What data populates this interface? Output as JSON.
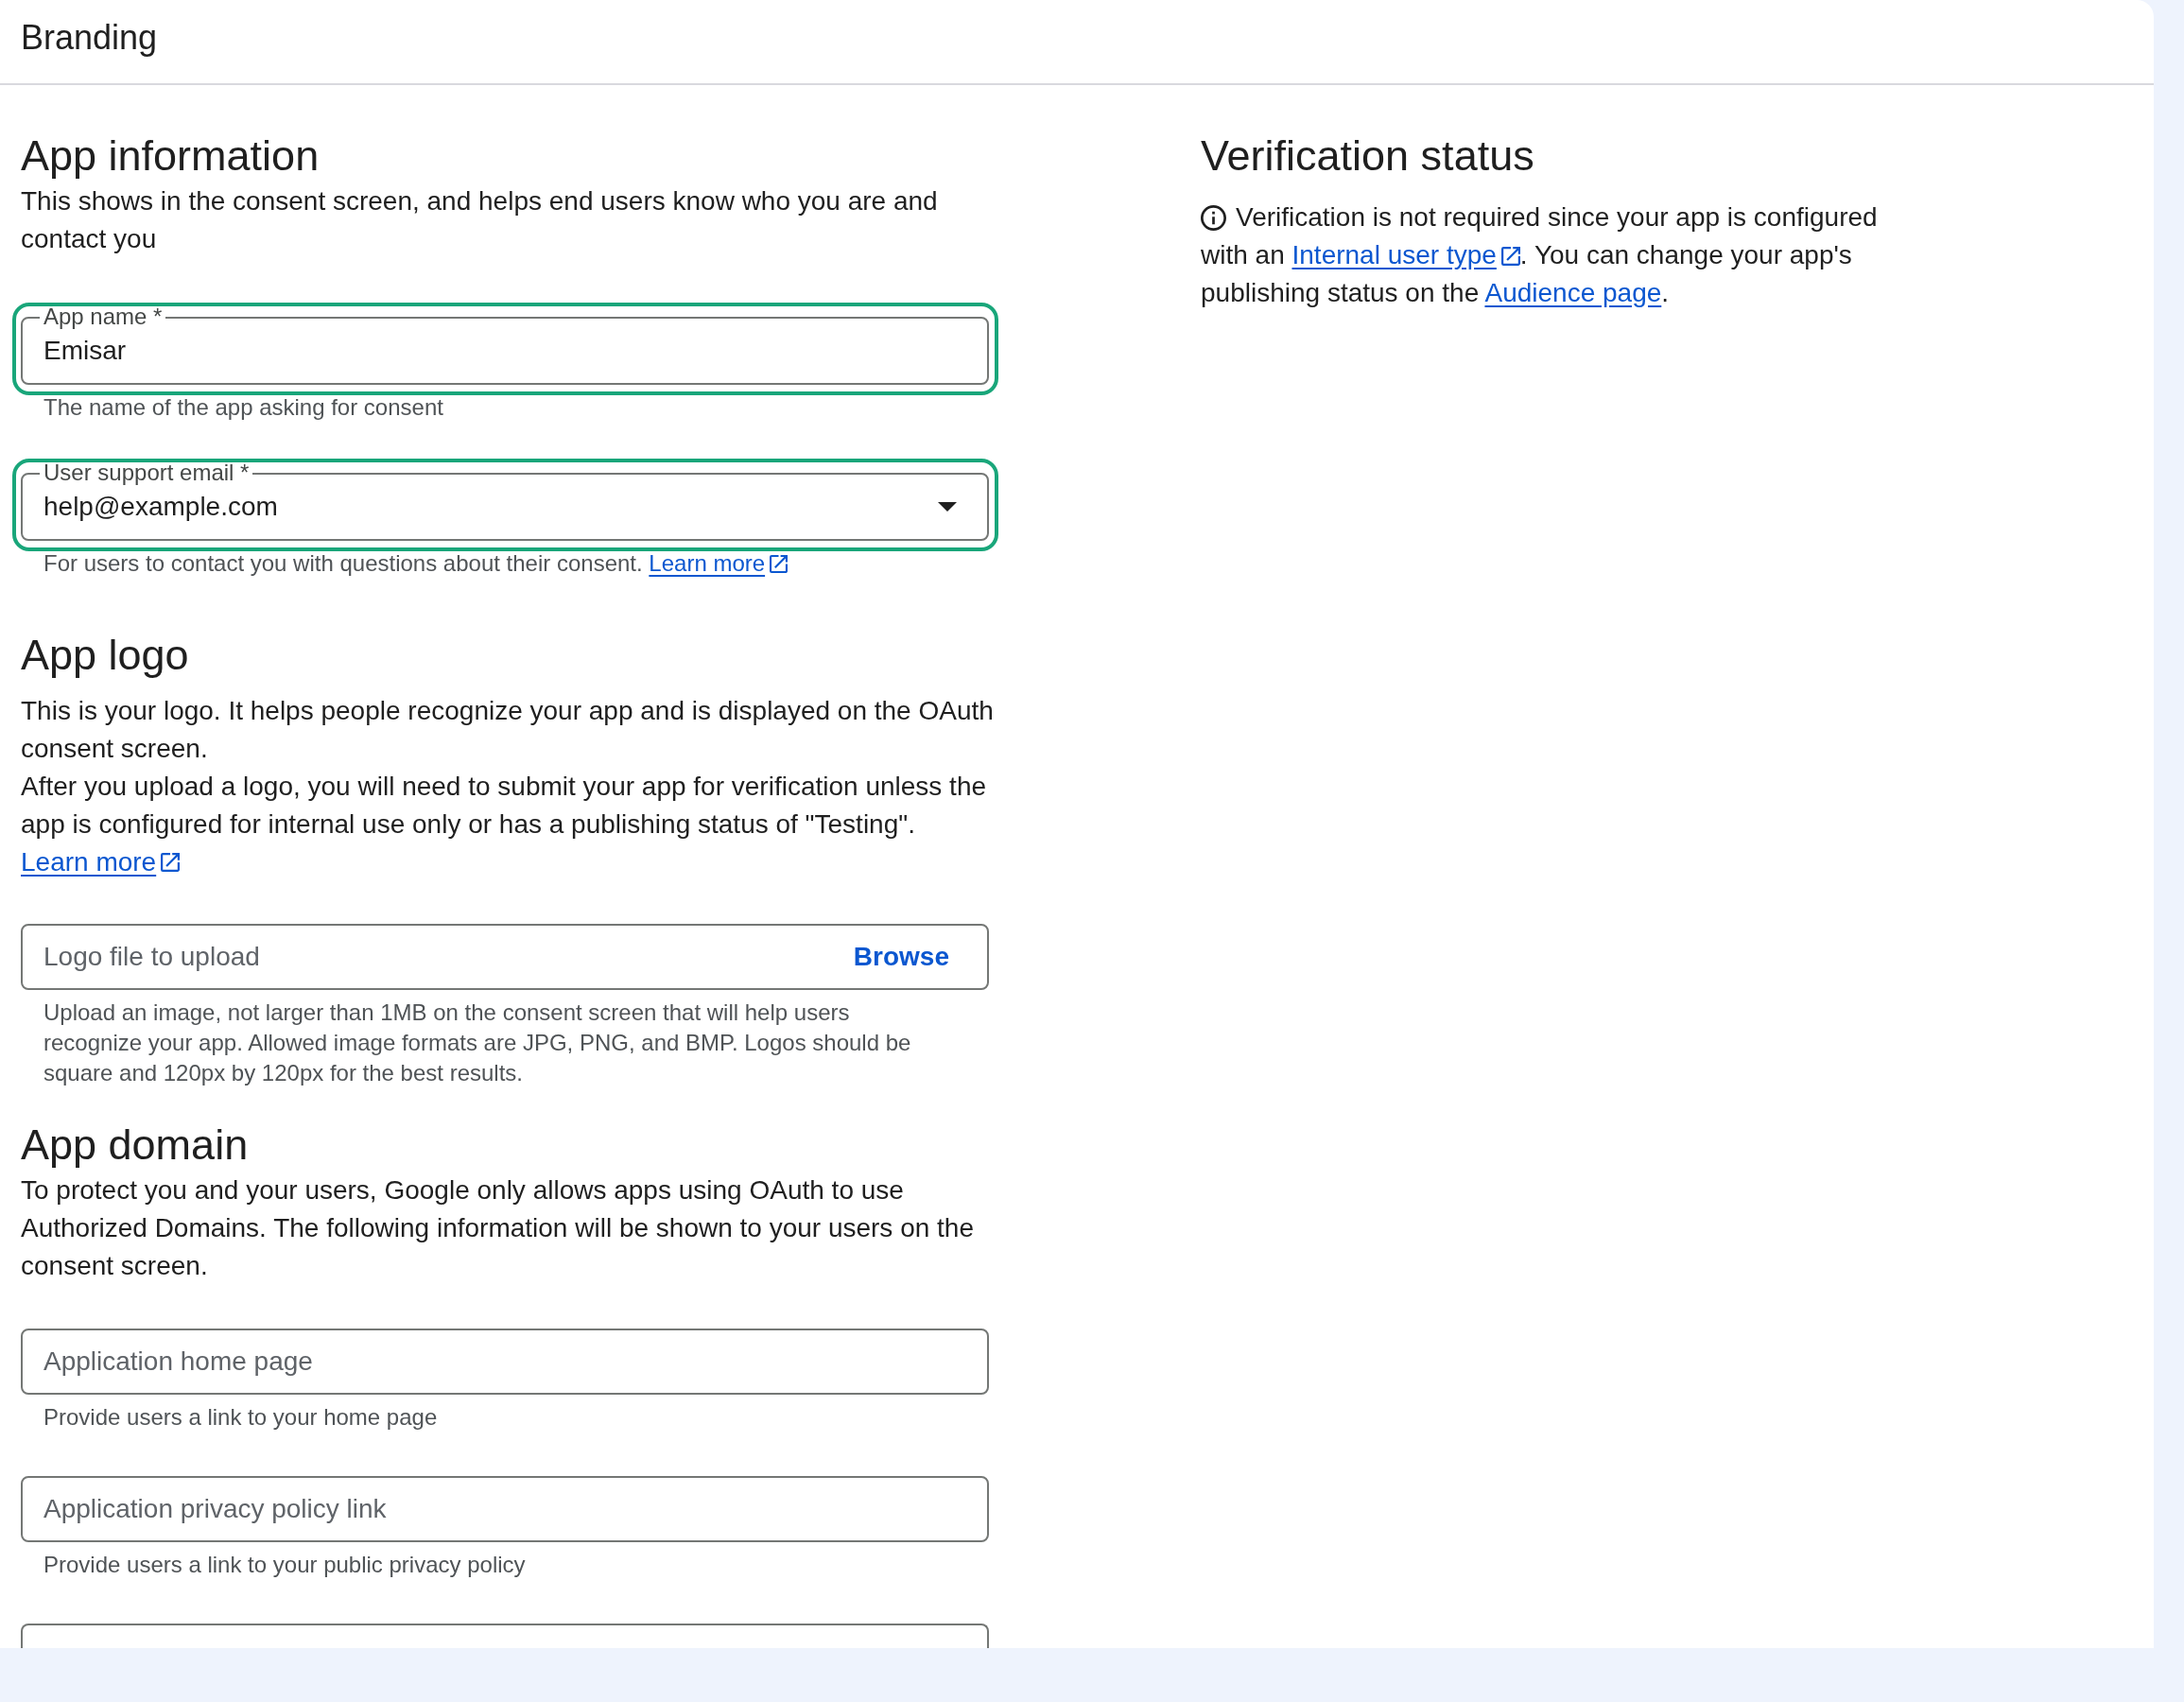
{
  "page_title": "Branding",
  "app_information": {
    "title": "App information",
    "description": "This shows in the consent screen, and helps end users know who you are and contact you",
    "fields": [
      {
        "kind": "text",
        "label": "App name *",
        "value": "Emisar",
        "hint": [
          {
            "kind": "text",
            "text": "The name of the app asking for consent"
          }
        ],
        "highlighted": true
      },
      {
        "kind": "dropdown",
        "label": "User support email *",
        "value": "help@example.com",
        "hint": [
          {
            "kind": "text",
            "text": "For users to contact you with questions about their consent. "
          },
          {
            "kind": "link",
            "text": "Learn more",
            "external": true
          }
        ],
        "highlighted": true
      }
    ]
  },
  "app_logo": {
    "title": "App logo",
    "paragraphs": [
      "This is your logo. It helps people recognize your app and is displayed on the OAuth consent screen.",
      "After you upload a logo, you will need to submit your app for verification unless the app is configured for internal use only or has a publishing status of \"Testing\"."
    ],
    "link": {
      "text": "Learn more",
      "external": true
    },
    "upload": {
      "placeholder": "Logo file to upload",
      "button": "Browse",
      "hint": "Upload an image, not larger than 1MB on the consent screen that will help users recognize your app. Allowed image formats are JPG, PNG, and BMP. Logos should be square and 120px by 120px for the best results."
    }
  },
  "app_domain": {
    "title": "App domain",
    "description": "To protect you and your users, Google only allows apps using OAuth to use Authorized Domains. The following information will be shown to your users on the consent screen.",
    "fields": [
      {
        "kind": "text",
        "placeholder": "Application home page",
        "hint": "Provide users a link to your home page"
      },
      {
        "kind": "text",
        "placeholder": "Application privacy policy link",
        "hint": "Provide users a link to your public privacy policy"
      },
      {
        "kind": "clipped"
      }
    ]
  },
  "verification": {
    "title": "Verification status",
    "parts": [
      {
        "kind": "text",
        "text": "Verification is not required since your app is configured with an "
      },
      {
        "kind": "link",
        "text": "Internal user type",
        "external": true
      },
      {
        "kind": "text",
        "text": ". You can change your app's publishing status on the "
      },
      {
        "kind": "link",
        "text": "Audience page",
        "external": false
      },
      {
        "kind": "text",
        "text": "."
      }
    ]
  }
}
